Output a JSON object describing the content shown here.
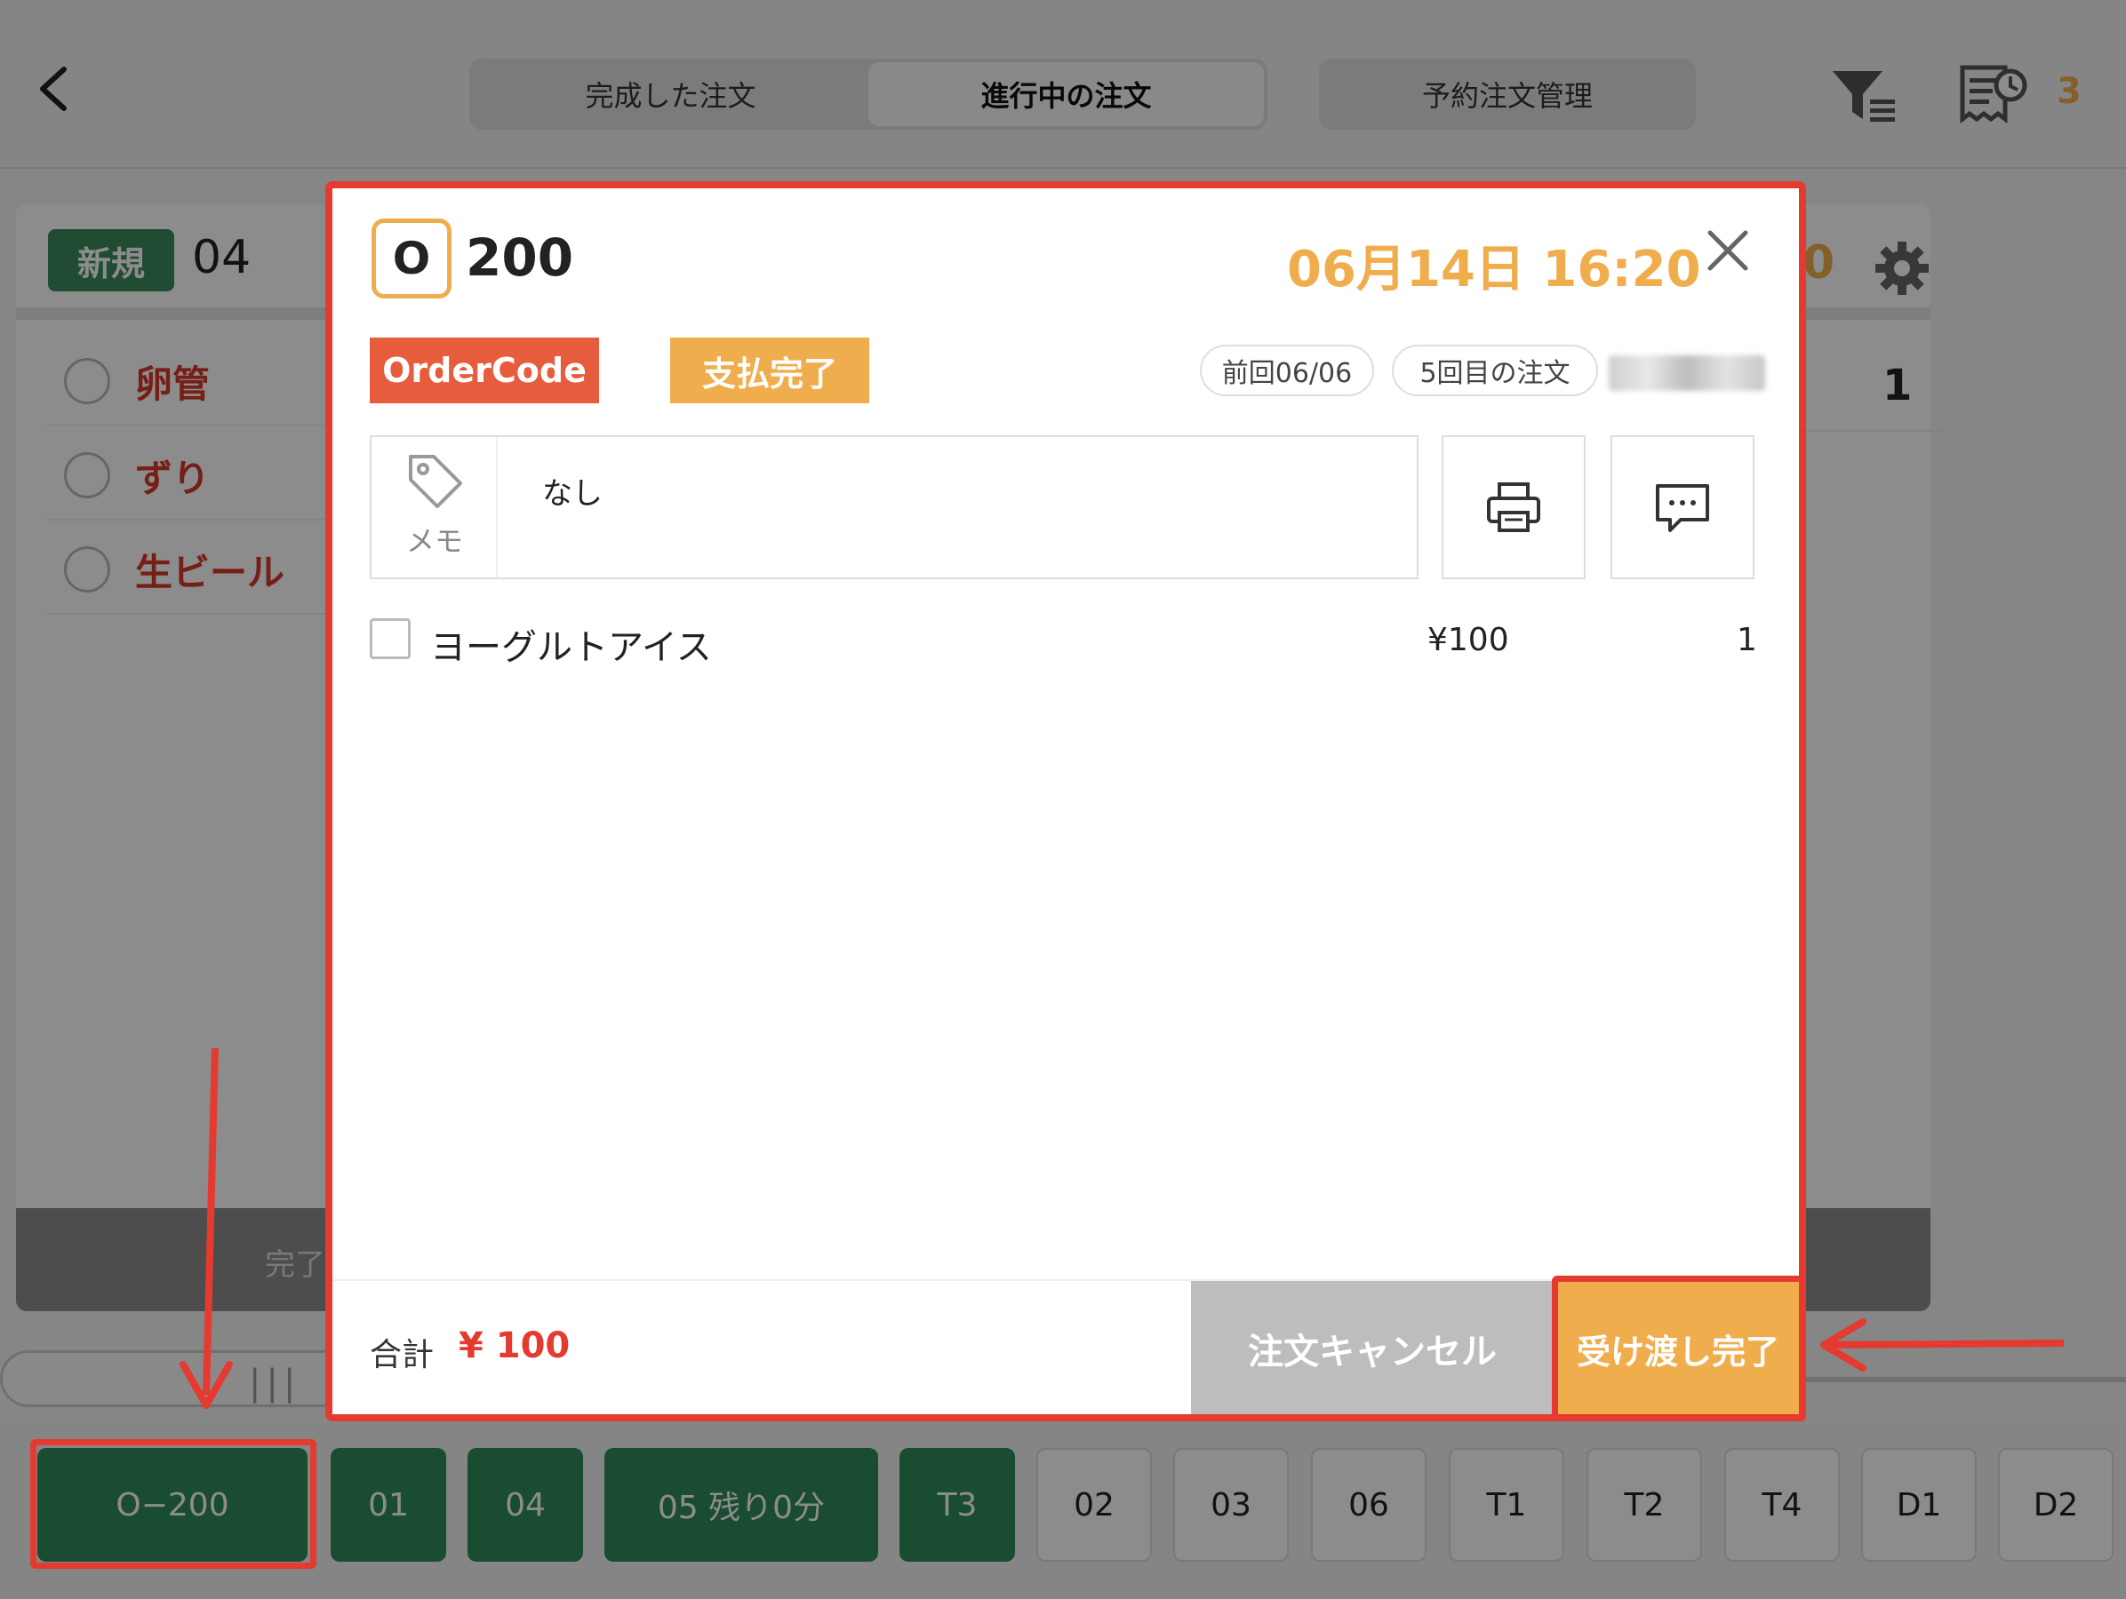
{
  "header": {
    "tabs": [
      {
        "label": "完成した注文"
      },
      {
        "label": "進行中の注文"
      }
    ],
    "reserve_tab": "予約注文管理",
    "receipt_count": "3"
  },
  "card": {
    "badge": "新規",
    "number": "04",
    "right_number": "0",
    "items": [
      {
        "name": "卵管"
      },
      {
        "name": "ずり"
      },
      {
        "name": "生ビール"
      }
    ],
    "right_qty": "1",
    "footer_label": "完了"
  },
  "order_bar": [
    {
      "label": "O−200"
    },
    {
      "label": "01"
    },
    {
      "label": "04"
    },
    {
      "label": "05  残り0分"
    },
    {
      "label": "T3"
    },
    {
      "label": "02"
    },
    {
      "label": "03"
    },
    {
      "label": "06"
    },
    {
      "label": "T1"
    },
    {
      "label": "T2"
    },
    {
      "label": "T4"
    },
    {
      "label": "D1"
    },
    {
      "label": "D2"
    }
  ],
  "modal": {
    "order_type": "O",
    "order_number": "200",
    "date": "06月14日 16:20",
    "tag_code": "OrderCode",
    "tag_paid": "支払完了",
    "previous": "前回06/06",
    "order_count": "5回目の注文",
    "memo_label": "メモ",
    "memo_text": "なし",
    "item": {
      "name": "ヨーグルトアイス",
      "price": "¥100",
      "qty": "1"
    },
    "total_label": "合計",
    "total_value": "¥ 100",
    "cancel_label": "注文キャンセル",
    "complete_label": "受け渡し完了"
  },
  "colors": {
    "accent_orange": "#f0ad4e",
    "order_code": "#e65c3c",
    "green": "#2f8a58",
    "annotation_red": "#e53a2f"
  }
}
